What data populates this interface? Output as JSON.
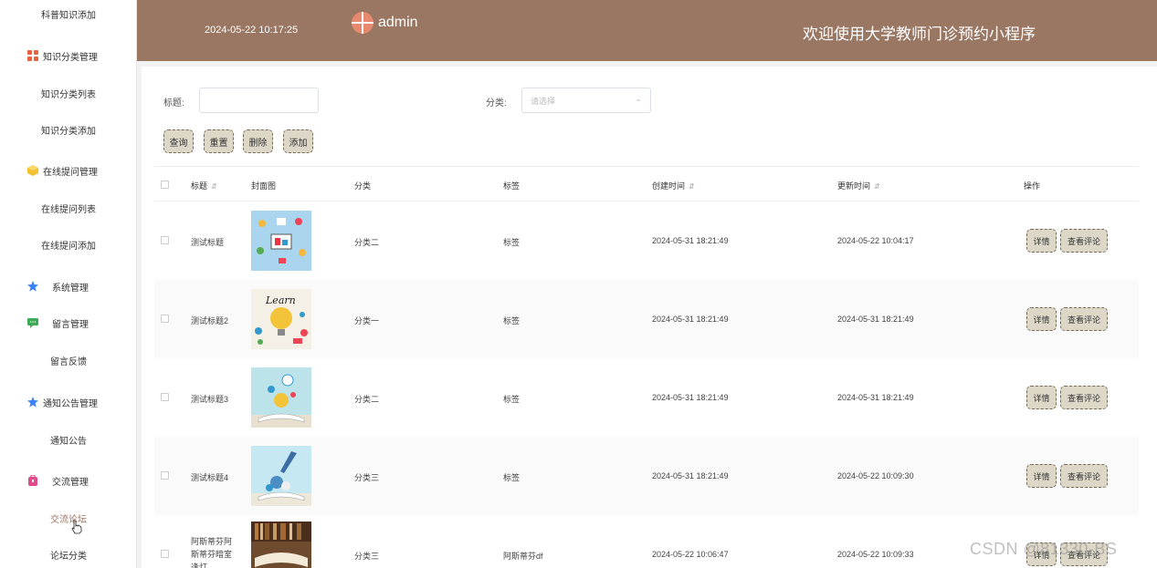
{
  "sidebar": {
    "items": [
      {
        "label": "科普知识添加",
        "kind": "sub"
      },
      {
        "label": "知识分类管理",
        "kind": "group",
        "icon": "grid-icon"
      },
      {
        "label": "知识分类列表",
        "kind": "sub"
      },
      {
        "label": "知识分类添加",
        "kind": "sub"
      },
      {
        "label": "在线提问管理",
        "kind": "group",
        "icon": "cube-icon"
      },
      {
        "label": "在线提问列表",
        "kind": "sub"
      },
      {
        "label": "在线提问添加",
        "kind": "sub"
      },
      {
        "label": "系统管理",
        "kind": "group",
        "icon": "star-icon"
      },
      {
        "label": "留言管理",
        "kind": "group",
        "icon": "chat-icon"
      },
      {
        "label": "留言反馈",
        "kind": "sub"
      },
      {
        "label": "通知公告管理",
        "kind": "group",
        "icon": "star-icon"
      },
      {
        "label": "通知公告",
        "kind": "sub"
      },
      {
        "label": "交流管理",
        "kind": "group",
        "icon": "bag-icon"
      },
      {
        "label": "交流论坛",
        "kind": "sub",
        "active": true
      },
      {
        "label": "论坛分类",
        "kind": "sub"
      }
    ]
  },
  "header": {
    "datetime": "2024-05-22 10:17:25",
    "username": "admin",
    "title": "欢迎使用大学教师门诊预约小程序"
  },
  "search": {
    "title_label": "标题:",
    "title_value": "",
    "category_label": "分类:",
    "category_placeholder": "请选择",
    "buttons": [
      "查询",
      "重置",
      "删除",
      "添加"
    ]
  },
  "table": {
    "columns": [
      "标题",
      "封面图",
      "分类",
      "标签",
      "创建时间",
      "更新时间",
      "操作"
    ],
    "rows": [
      {
        "title": "测试标题",
        "category": "分类二",
        "tag": "标签",
        "created": "2024-05-31 18:21:49",
        "updated": "2024-05-22 10:04:17"
      },
      {
        "title": "测试标题2",
        "category": "分类一",
        "tag": "标签",
        "created": "2024-05-31 18:21:49",
        "updated": "2024-05-31 18:21:49"
      },
      {
        "title": "测试标题3",
        "category": "分类二",
        "tag": "标签",
        "created": "2024-05-31 18:21:49",
        "updated": "2024-05-31 18:21:49"
      },
      {
        "title": "测试标题4",
        "category": "分类三",
        "tag": "标签",
        "created": "2024-05-31 18:21:49",
        "updated": "2024-05-22 10:09:30"
      },
      {
        "title_lines": [
          "阿斯蒂芬阿",
          "斯蒂芬暗室",
          "逢灯"
        ],
        "category": "分类三",
        "tag": "阿斯蒂芬df",
        "created": "2024-05-22 10:06:47",
        "updated": "2024-05-22 10:09:33"
      }
    ],
    "row_actions": [
      "详情",
      "查看评论"
    ]
  },
  "watermark": "CSDN @81330-BS",
  "colors": {
    "header_bg": "#9a7763",
    "button_bg": "#ddd7c8",
    "active_menu": "#9b7560"
  }
}
